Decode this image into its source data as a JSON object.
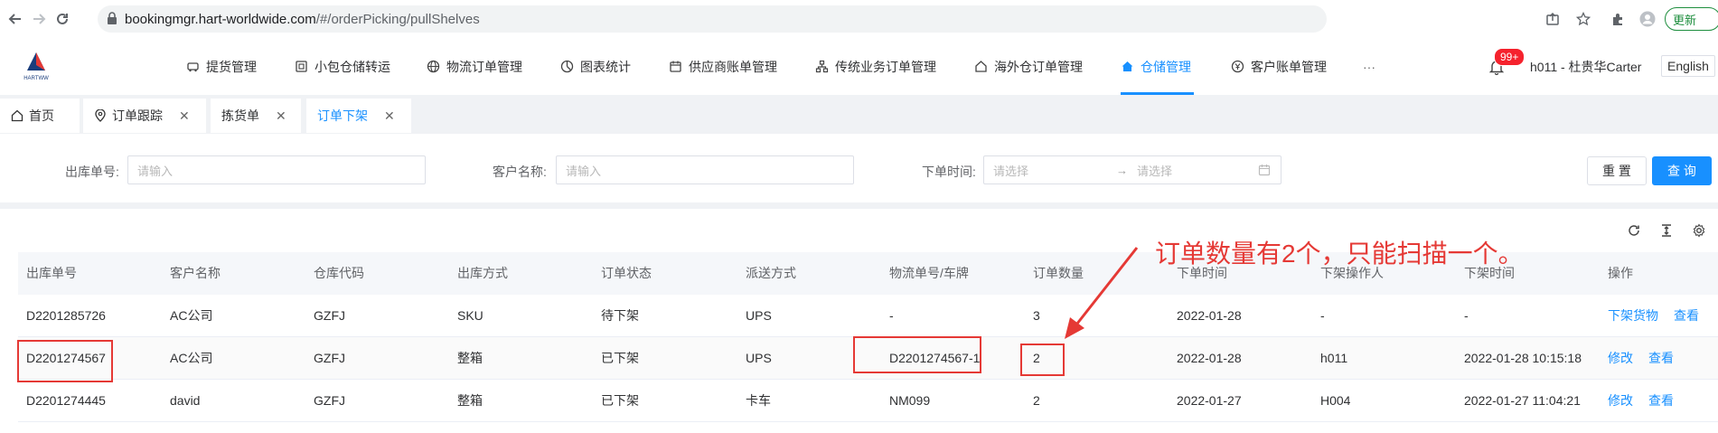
{
  "browser": {
    "url_host": "bookingmgr.hart-worldwide.com",
    "url_path": "/#/orderPicking/pullShelves",
    "update_label": "更新"
  },
  "header": {
    "logo_text": "HARTWW",
    "menu": [
      {
        "label": "提货管理",
        "icon": "truck-icon"
      },
      {
        "label": "小包仓储转运",
        "icon": "package-icon"
      },
      {
        "label": "物流订单管理",
        "icon": "globe-icon"
      },
      {
        "label": "图表统计",
        "icon": "chart-icon"
      },
      {
        "label": "供应商账单管理",
        "icon": "calendar-icon"
      },
      {
        "label": "传统业务订单管理",
        "icon": "network-icon"
      },
      {
        "label": "海外仓订单管理",
        "icon": "home-icon"
      },
      {
        "label": "仓储管理",
        "icon": "home-filled-icon"
      },
      {
        "label": "客户账单管理",
        "icon": "yen-icon"
      }
    ],
    "more": "···",
    "badge": "99+",
    "user": "h011 - 杜贵华Carter",
    "lang": "English",
    "accent_color": "#1890ff"
  },
  "tabs": [
    {
      "label": "首页"
    },
    {
      "label": "订单跟踪"
    },
    {
      "label": "拣货单"
    },
    {
      "label": "订单下架"
    }
  ],
  "search": {
    "outbound_label": "出库单号:",
    "outbound_placeholder": "请输入",
    "customer_label": "客户名称:",
    "customer_placeholder": "请输入",
    "time_label": "下单时间:",
    "time_start_placeholder": "请选择",
    "time_end_placeholder": "请选择",
    "reset_label": "重 置",
    "query_label": "查 询"
  },
  "table": {
    "columns": [
      "出库单号",
      "客户名称",
      "仓库代码",
      "出库方式",
      "订单状态",
      "派送方式",
      "物流单号/车牌",
      "订单数量",
      "下单时间",
      "下架操作人",
      "下架时间",
      "操作"
    ],
    "rows": [
      {
        "cells": [
          "D2201285726",
          "AC公司",
          "GZFJ",
          "SKU",
          "待下架",
          "UPS",
          "-",
          "3",
          "2022-01-28",
          "-",
          "-"
        ],
        "actions": [
          "下架货物",
          "查看"
        ]
      },
      {
        "cells": [
          "D2201274567",
          "AC公司",
          "GZFJ",
          "整箱",
          "已下架",
          "UPS",
          "D2201274567-1",
          "2",
          "2022-01-28",
          "h011",
          "2022-01-28 10:15:18"
        ],
        "actions": [
          "修改",
          "查看"
        ]
      },
      {
        "cells": [
          "D2201274445",
          "david",
          "GZFJ",
          "整箱",
          "已下架",
          "卡车",
          "NM099",
          "2",
          "2022-01-27",
          "H004",
          "2022-01-27 11:04:21"
        ],
        "actions": [
          "修改",
          "查看"
        ]
      }
    ]
  },
  "annotation": {
    "text": "订单数量有2个，只能扫描一个。",
    "color": "#e53935"
  }
}
